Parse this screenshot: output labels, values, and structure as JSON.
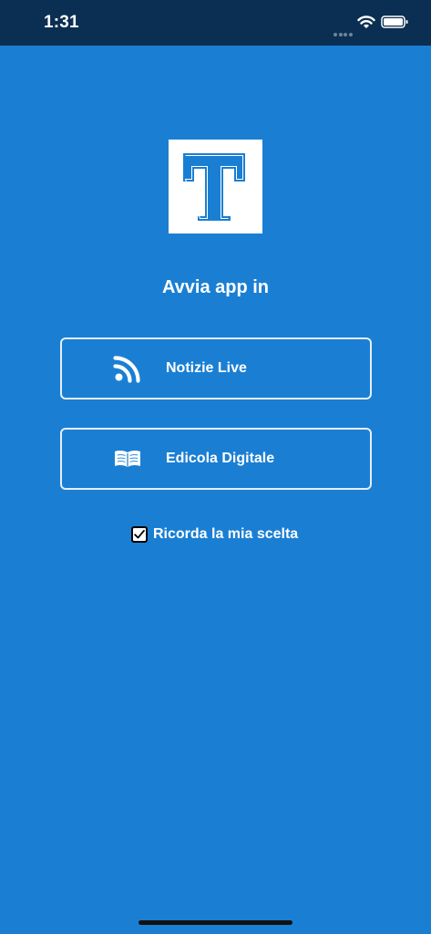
{
  "status_bar": {
    "time": "1:31",
    "icons": [
      "signal-dots-icon",
      "wifi-icon",
      "battery-icon"
    ]
  },
  "logo": {
    "icon": "t-logo-icon",
    "letter": "T",
    "color": "#1a7fd3"
  },
  "headline": "Avvia app in",
  "options": [
    {
      "label": "Notizie Live",
      "icon": "rss-feed-icon"
    },
    {
      "label": "Edicola Digitale",
      "icon": "open-book-icon"
    }
  ],
  "remember": {
    "label": "Ricorda la mia scelta",
    "checked": true
  },
  "colors": {
    "background": "#1a7fd3",
    "status_bar": "#0b2f52",
    "text": "#ffffff",
    "button_border": "#e5eef7"
  }
}
